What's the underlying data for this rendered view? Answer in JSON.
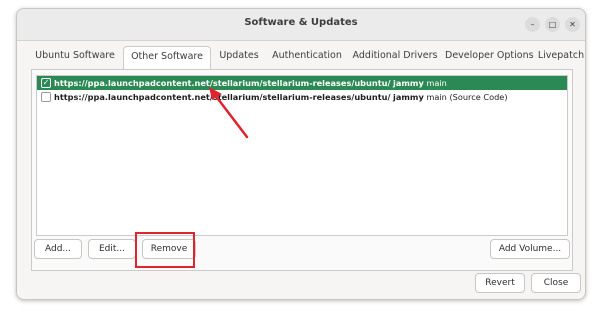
{
  "window": {
    "title": "Software & Updates",
    "controls": {
      "minimize": "–",
      "maximize": "□",
      "close": "✕"
    }
  },
  "tabs": [
    {
      "label": "Ubuntu Software"
    },
    {
      "label": "Other Software",
      "active": true
    },
    {
      "label": "Updates"
    },
    {
      "label": "Authentication"
    },
    {
      "label": "Additional Drivers"
    },
    {
      "label": "Developer Options"
    },
    {
      "label": "Livepatch"
    }
  ],
  "sources": [
    {
      "checked": true,
      "selected": true,
      "url": "https://ppa.launchpadcontent.net/stellarium/stellarium-releases/ubuntu/",
      "dist": "jammy",
      "suffix": "main"
    },
    {
      "checked": false,
      "selected": false,
      "url": "https://ppa.launchpadcontent.net/stellarium/stellarium-releases/ubuntu/",
      "dist": "jammy",
      "suffix": "main (Source Code)"
    }
  ],
  "buttons": {
    "add": "Add...",
    "edit": "Edit...",
    "remove": "Remove",
    "add_volume": "Add Volume...",
    "revert": "Revert",
    "close": "Close"
  },
  "colors": {
    "selection": "#2b8a53",
    "annotation": "#e0242e"
  }
}
